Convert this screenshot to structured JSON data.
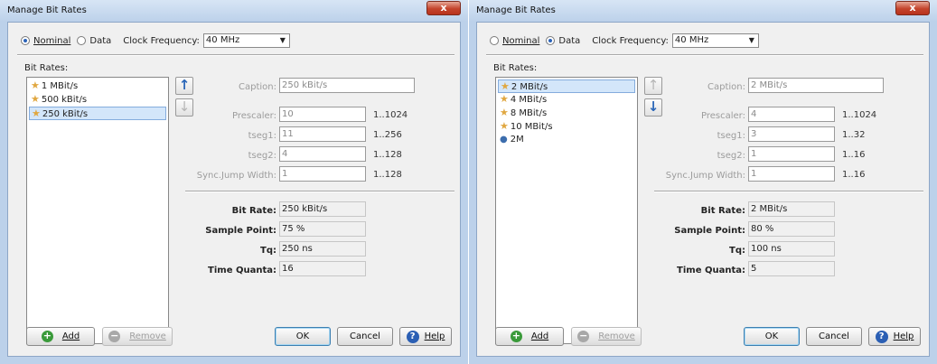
{
  "dialogs": [
    {
      "title": "Manage Bit Rates",
      "close_label": "x",
      "mode": {
        "nominal_label": "Nominal",
        "data_label": "Data",
        "selected": "Nominal"
      },
      "clock_frequency_label": "Clock Frequency:",
      "clock_frequency_value": "40 MHz",
      "bit_rates_label": "Bit Rates:",
      "bit_rates": [
        {
          "label": "1 MBit/s",
          "icon": "star-icon",
          "selected": false
        },
        {
          "label": "500 kBit/s",
          "icon": "star-icon",
          "selected": false
        },
        {
          "label": "250 kBit/s",
          "icon": "star-icon",
          "selected": true
        }
      ],
      "move_up_enabled": true,
      "move_down_enabled": false,
      "fields": {
        "caption": {
          "label": "Caption:",
          "value": "250 kBit/s"
        },
        "prescaler": {
          "label": "Prescaler:",
          "value": "10",
          "range": "1..1024"
        },
        "tseg1": {
          "label": "tseg1:",
          "value": "11",
          "range": "1..256"
        },
        "tseg2": {
          "label": "tseg2:",
          "value": "4",
          "range": "1..128"
        },
        "sjw": {
          "label": "Sync.Jump Width:",
          "value": "1",
          "range": "1..128"
        }
      },
      "results": {
        "bit_rate": {
          "label": "Bit Rate:",
          "value": "250 kBit/s"
        },
        "sample_point": {
          "label": "Sample Point:",
          "value": "75 %"
        },
        "tq": {
          "label": "Tq:",
          "value": "250 ns"
        },
        "time_quanta": {
          "label": "Time Quanta:",
          "value": "16"
        }
      },
      "buttons": {
        "add": "Add",
        "remove": "Remove",
        "ok": "OK",
        "cancel": "Cancel",
        "help": "Help"
      }
    },
    {
      "title": "Manage Bit Rates",
      "close_label": "x",
      "mode": {
        "nominal_label": "Nominal",
        "data_label": "Data",
        "selected": "Data"
      },
      "clock_frequency_label": "Clock Frequency:",
      "clock_frequency_value": "40 MHz",
      "bit_rates_label": "Bit Rates:",
      "bit_rates": [
        {
          "label": "2 MBit/s",
          "icon": "star-icon",
          "selected": true
        },
        {
          "label": "4 MBit/s",
          "icon": "star-icon",
          "selected": false
        },
        {
          "label": "8 MBit/s",
          "icon": "star-icon",
          "selected": false
        },
        {
          "label": "10 MBit/s",
          "icon": "star-icon",
          "selected": false
        },
        {
          "label": "2M",
          "icon": "user-icon",
          "selected": false
        }
      ],
      "move_up_enabled": false,
      "move_down_enabled": true,
      "fields": {
        "caption": {
          "label": "Caption:",
          "value": "2 MBit/s"
        },
        "prescaler": {
          "label": "Prescaler:",
          "value": "4",
          "range": "1..1024"
        },
        "tseg1": {
          "label": "tseg1:",
          "value": "3",
          "range": "1..32"
        },
        "tseg2": {
          "label": "tseg2:",
          "value": "1",
          "range": "1..16"
        },
        "sjw": {
          "label": "Sync.Jump Width:",
          "value": "1",
          "range": "1..16"
        }
      },
      "results": {
        "bit_rate": {
          "label": "Bit Rate:",
          "value": "2 MBit/s"
        },
        "sample_point": {
          "label": "Sample Point:",
          "value": "80 %"
        },
        "tq": {
          "label": "Tq:",
          "value": "100 ns"
        },
        "time_quanta": {
          "label": "Time Quanta:",
          "value": "5"
        }
      },
      "buttons": {
        "add": "Add",
        "remove": "Remove",
        "ok": "OK",
        "cancel": "Cancel",
        "help": "Help"
      }
    }
  ]
}
